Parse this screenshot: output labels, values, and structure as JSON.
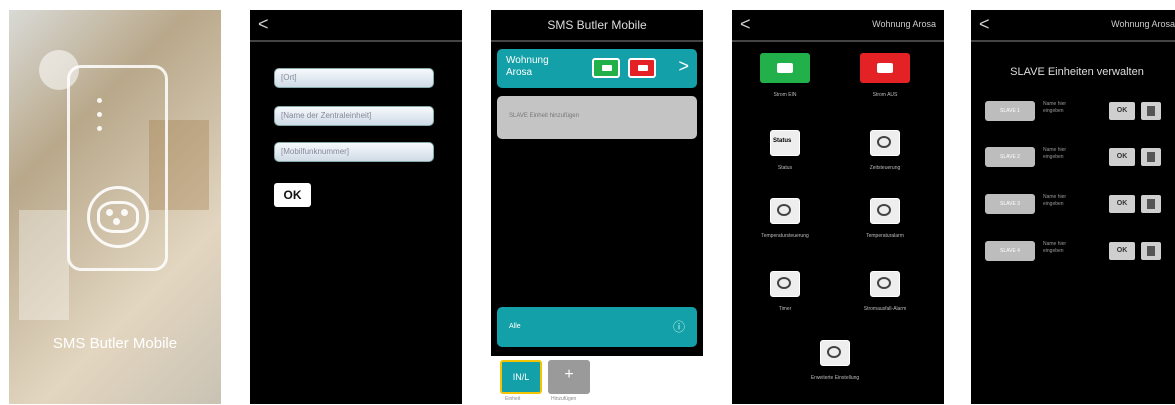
{
  "splash": {
    "app_title": "SMS Butler Mobile"
  },
  "setup": {
    "back": "<",
    "fields": [
      "[Ort]",
      "[Name der Zentraleinheit]",
      "[Mobilfunknummer]"
    ],
    "ok_label": "OK"
  },
  "main": {
    "header": "SMS Butler Mobile",
    "device_name": "Wohnung Arosa",
    "slave_bar_label": "SLAVE Einheit hinzufügen",
    "alle_label": "Alle",
    "tabs": [
      {
        "label": "Einheit",
        "button": "IN/L"
      },
      {
        "label": "Hinzufügen",
        "button": "+"
      }
    ]
  },
  "device": {
    "back": "<",
    "title": "Wohnung Arosa",
    "items": [
      {
        "label": "Strom EIN",
        "icon": "plug-on-icon"
      },
      {
        "label": "Strom AUS",
        "icon": "plug-off-icon"
      },
      {
        "label": "Status",
        "icon": "status-icon",
        "text": "Status"
      },
      {
        "label": "Zeitsteuerung",
        "icon": "clock-icon"
      },
      {
        "label": "Temperatursteuerung",
        "icon": "thermostat-icon"
      },
      {
        "label": "Temperaturalarm",
        "icon": "temperature-alarm-icon"
      },
      {
        "label": "Timer",
        "icon": "timer-icon"
      },
      {
        "label": "Stromausfall-Alarm",
        "icon": "power-alarm-icon"
      },
      {
        "label": "Erweiterte Einstellung",
        "icon": "gear-icon"
      }
    ]
  },
  "slaves": {
    "back": "<",
    "title": "Wohnung Arosa",
    "heading": "SLAVE Einheiten verwalten",
    "rows": [
      {
        "slave": "SLAVE 1",
        "name": "Name hier eingeben",
        "ok": "OK"
      },
      {
        "slave": "SLAVE 2",
        "name": "Name hier eingeben",
        "ok": "OK"
      },
      {
        "slave": "SLAVE 3",
        "name": "Name hier eingeben",
        "ok": "OK"
      },
      {
        "slave": "SLAVE 4",
        "name": "Name hier eingeben",
        "ok": "OK"
      }
    ]
  },
  "colors": {
    "teal": "#14a0a8",
    "green": "#22b04a",
    "red": "#e42226"
  }
}
